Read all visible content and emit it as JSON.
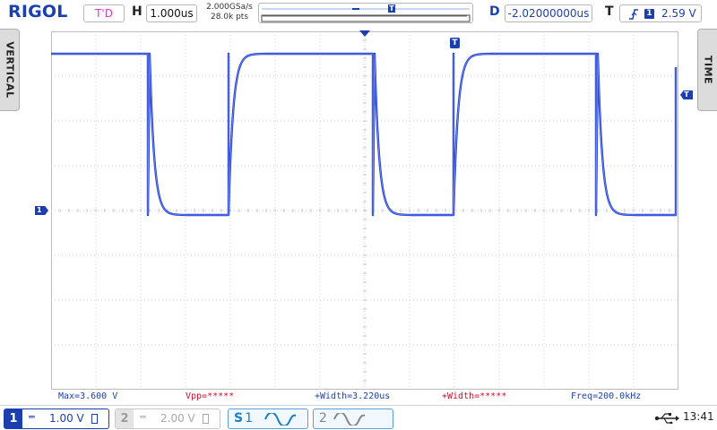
{
  "top_bar": {
    "brand": "RIGOL",
    "trigger_status": "T'D",
    "horizontal_label": "H",
    "timebase": "1.000us",
    "sample_rate": "2.000GSa/s",
    "memory_depth": "28.0k pts",
    "memory_marker": "T",
    "delay_label": "D",
    "delay_value": "-2.02000000us",
    "trigger_label": "T",
    "trigger_source": "1",
    "trigger_level": "2.59 V"
  },
  "side_tabs": {
    "left_label": "VERTICAL",
    "right_label": "TIME"
  },
  "screen": {
    "trigger_position_marker": "T",
    "trigger_level_marker": "T",
    "channel1_ground_marker": "1"
  },
  "measurements": {
    "max": "Max=3.600 V",
    "vpp": "Vpp=*****",
    "pos_width": "+Width=3.220us",
    "pos_width2": "+Width=*****",
    "freq": "Freq=200.0kHz"
  },
  "bottom_bar": {
    "ch1_number": "1",
    "ch1_coupling": "═",
    "ch1_scale": "1.00 V",
    "ch2_number": "2",
    "ch2_coupling": "═",
    "ch2_scale": "2.00 V",
    "math1_label": "S",
    "math1_sub": "1",
    "math2_label": "2",
    "clock": "13:41"
  },
  "colors": {
    "brand": "#1c3fb0",
    "channel1": "#1c3fb0",
    "trigger_status": "#d040c8",
    "measurement_max": "#1c3fb0",
    "measurement_vpp": "#c8102e",
    "grid": "#c9c9c9"
  },
  "icons": {
    "rising_edge": "rising-edge-icon",
    "usb": "usb-icon",
    "bandwidth_limit": "bandwidth-icon",
    "sine_wave": "sine-wave-icon"
  }
}
